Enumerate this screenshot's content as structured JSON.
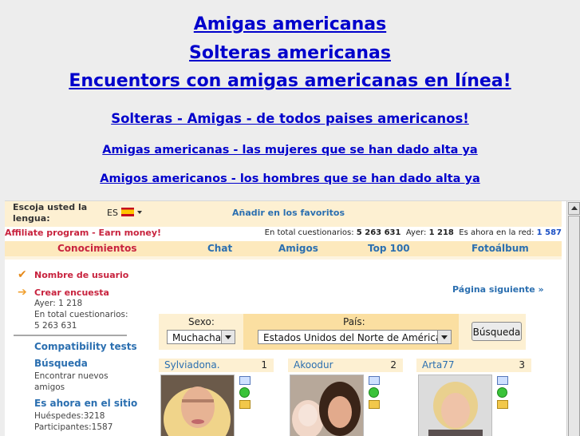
{
  "headlines": [
    "Amigas americanas",
    "Solteras americanas",
    "Encuentors con amigas americanas en línea!",
    "Solteras - Amigas - de todos paises americanos!",
    "Amigas americanas - las mujeres que se han dado alta ya",
    "Amigos americanos - los hombres que se han dado alta ya"
  ],
  "topbar": {
    "lang_label": "Escoja usted la lengua:",
    "lang_value": "ES",
    "favorites": "Añadir en los favoritos"
  },
  "statbar": {
    "affiliate": "Affiliate program - Earn money!",
    "total_label": "En total cuestionarios:",
    "total_value": "5 263 631",
    "yesterday_label": "Ayer:",
    "yesterday_value": "1 218",
    "online_label": "Es ahora en la red:",
    "online_value": "1 587"
  },
  "nav": [
    "Conocimientos",
    "Chat",
    "Amigos",
    "Top 100",
    "Fotoálbum"
  ],
  "sidebar": {
    "username": "Nombre de usuario",
    "create_survey": "Crear encuesta",
    "yesterday": "Ayer: 1 218",
    "total_label": "En total cuestionarios:",
    "total_value": "5 263 631",
    "compat": "Compatibility tests",
    "search": "Búsqueda",
    "search_sub1": "Encontrar nuevos",
    "search_sub2": "amigos",
    "online": "Es ahora en el sitio",
    "guests": "Huéspedes:3218",
    "participants": "Participantes:1587"
  },
  "next_page": "Página siguiente »",
  "search": {
    "sex_label": "Sexo:",
    "sex_value": "Muchacha",
    "country_label": "País:",
    "country_value": "Estados Unidos del Norte de América",
    "button": "Búsqueda"
  },
  "profiles": [
    {
      "name": "Sylviadona.",
      "rank": "1"
    },
    {
      "name": "Akoodur",
      "rank": "2"
    },
    {
      "name": "Arta77",
      "rank": "3"
    }
  ],
  "colors": {
    "link_blue": "#0000cc",
    "accent_blue": "#2b6fb0",
    "accent_red": "#c8233e",
    "tan": "#fdf0d2"
  }
}
